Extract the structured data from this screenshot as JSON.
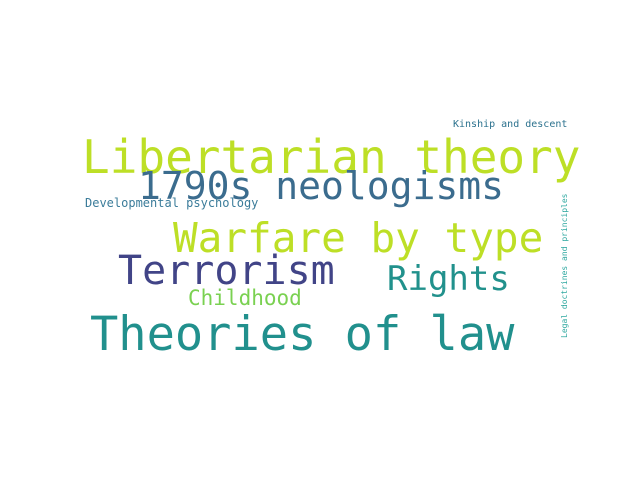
{
  "words": [
    {
      "text": "Libertarian theory",
      "color": "#bddf26"
    },
    {
      "text": "1790s neologisms",
      "color": "#3b6c8e"
    },
    {
      "text": "Warfare by type",
      "color": "#bddf26"
    },
    {
      "text": "Terrorism",
      "color": "#414487"
    },
    {
      "text": "Rights",
      "color": "#21918c"
    },
    {
      "text": "Childhood",
      "color": "#7ad151"
    },
    {
      "text": "Theories of law",
      "color": "#21908d"
    },
    {
      "text": "Developmental psychology",
      "color": "#3b7c9a"
    },
    {
      "text": "Kinship and descent",
      "color": "#2c728e"
    },
    {
      "text": "Legal doctrines and principles",
      "color": "#2ea8a0"
    }
  ]
}
